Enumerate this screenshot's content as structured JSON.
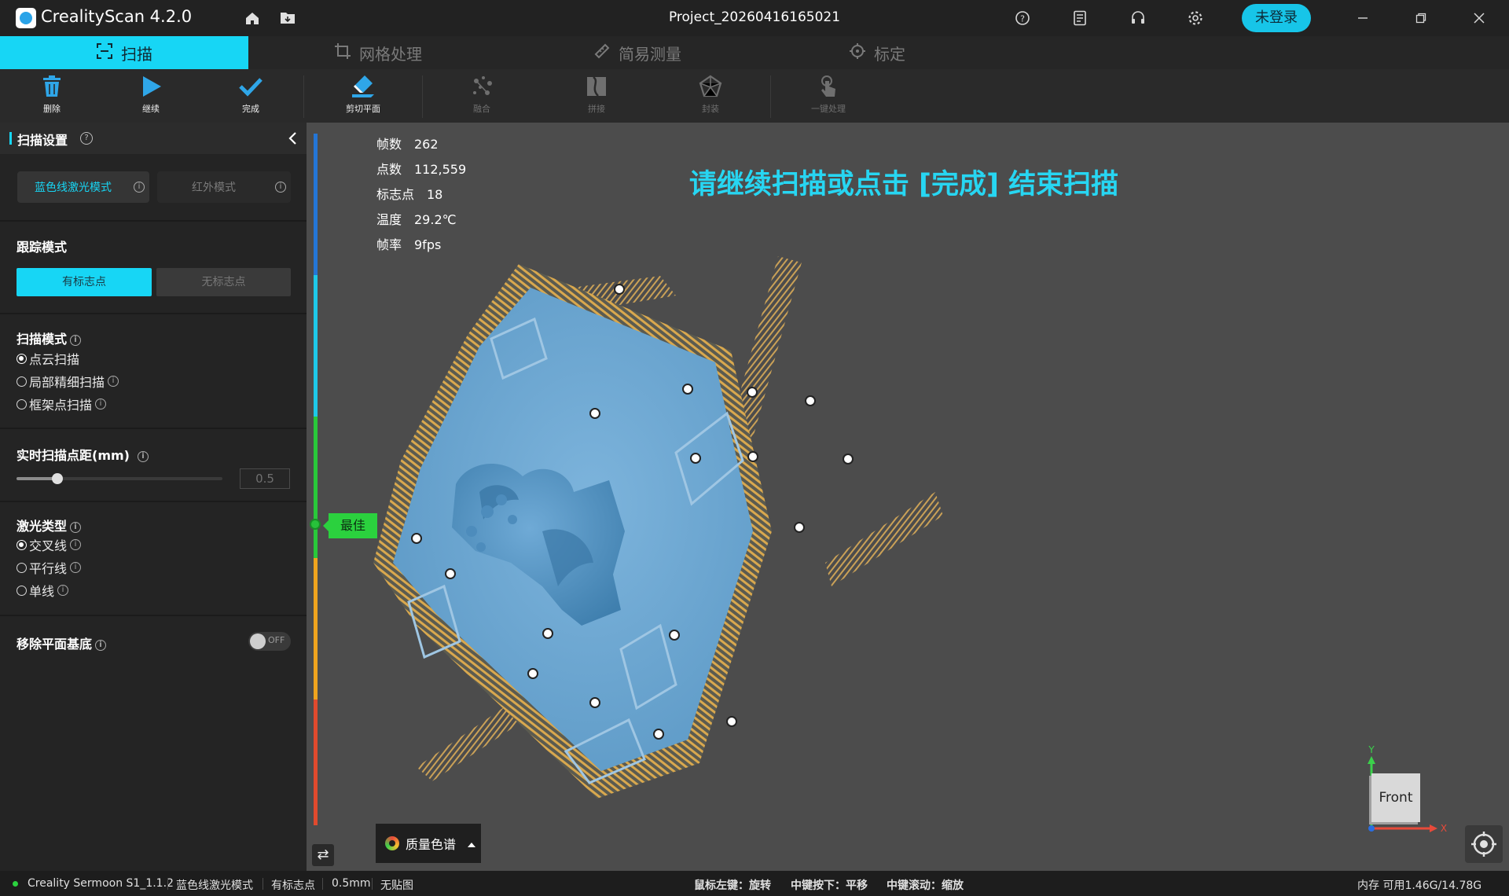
{
  "titlebar": {
    "app_name": "CrealityScan 4.2.0",
    "project": "Project_20260416165021",
    "login_label": "未登录",
    "icons": [
      "home-icon",
      "folder-icon",
      "help-icon",
      "document-icon",
      "headset-icon",
      "settings-icon",
      "minimize-icon",
      "restore-icon",
      "close-icon"
    ]
  },
  "tabs": [
    {
      "label": "扫描",
      "icon": "scan-icon",
      "active": true
    },
    {
      "label": "网格处理",
      "icon": "crop-icon",
      "active": false
    },
    {
      "label": "简易测量",
      "icon": "ruler-icon",
      "active": false
    },
    {
      "label": "标定",
      "icon": "crosshair-icon",
      "active": false
    }
  ],
  "toolbar": [
    {
      "label": "删除",
      "icon": "trash-icon",
      "enabled": true
    },
    {
      "label": "继续",
      "icon": "play-icon",
      "enabled": true
    },
    {
      "label": "完成",
      "icon": "check-icon",
      "enabled": true
    },
    {
      "label": "剪切平面",
      "icon": "cut-plane-icon",
      "enabled": true
    },
    {
      "label": "融合",
      "icon": "fuse-icon",
      "enabled": false
    },
    {
      "label": "拼接",
      "icon": "stitch-icon",
      "enabled": false
    },
    {
      "label": "封装",
      "icon": "mesh-icon",
      "enabled": false
    },
    {
      "label": "一键处理",
      "icon": "tap-icon",
      "enabled": false
    }
  ],
  "panel": {
    "title": "扫描设置",
    "scan_light_modes": {
      "blue_laser": "蓝色线激光模式",
      "infrared": "红外模式",
      "selected": "blue_laser"
    },
    "tracking": {
      "title": "跟踪模式",
      "with_markers": "有标志点",
      "without_markers": "无标志点",
      "selected": "with_markers"
    },
    "scan_mode": {
      "title": "扫描模式",
      "options": [
        "点云扫描",
        "局部精细扫描",
        "框架点扫描"
      ],
      "selected_index": 0
    },
    "point_distance": {
      "title": "实时扫描点距(mm)",
      "value": "0.5",
      "slider_fraction": 0.2
    },
    "laser_type": {
      "title": "激光类型",
      "options": [
        "交叉线",
        "平行线",
        "单线"
      ],
      "selected_index": 0
    },
    "remove_plane": {
      "title": "移除平面基底",
      "state": "OFF"
    }
  },
  "viewport": {
    "stats": [
      {
        "label": "帧数",
        "value": "262"
      },
      {
        "label": "点数",
        "value": "112,559"
      },
      {
        "label": "标志点",
        "value": "18"
      },
      {
        "label": "温度",
        "value": "29.2℃"
      },
      {
        "label": "帧率",
        "value": "9fps"
      }
    ],
    "hint": "请继续扫描或点击 [完成] 结束扫描",
    "quality_label": "最佳",
    "spectrum_label": "质量色谱",
    "axis": {
      "x": "X",
      "y": "Y",
      "view": "Front"
    },
    "colors": {
      "scan_blue": "#5c9dc9",
      "scan_edge": "#d9a84e",
      "accent": "#17d6f5"
    }
  },
  "statusbar": {
    "device": "Creality Sermoon S1_1.1.2",
    "mode": "蓝色线激光模式",
    "tracking": "有标志点",
    "distance": "0.5mm",
    "texture": "无贴图",
    "hint_rotate": "鼠标左键：旋转",
    "hint_pan": "中键按下：平移",
    "hint_zoom": "中键滚动：缩放",
    "memory": "内存 可用1.46G/14.78G"
  }
}
